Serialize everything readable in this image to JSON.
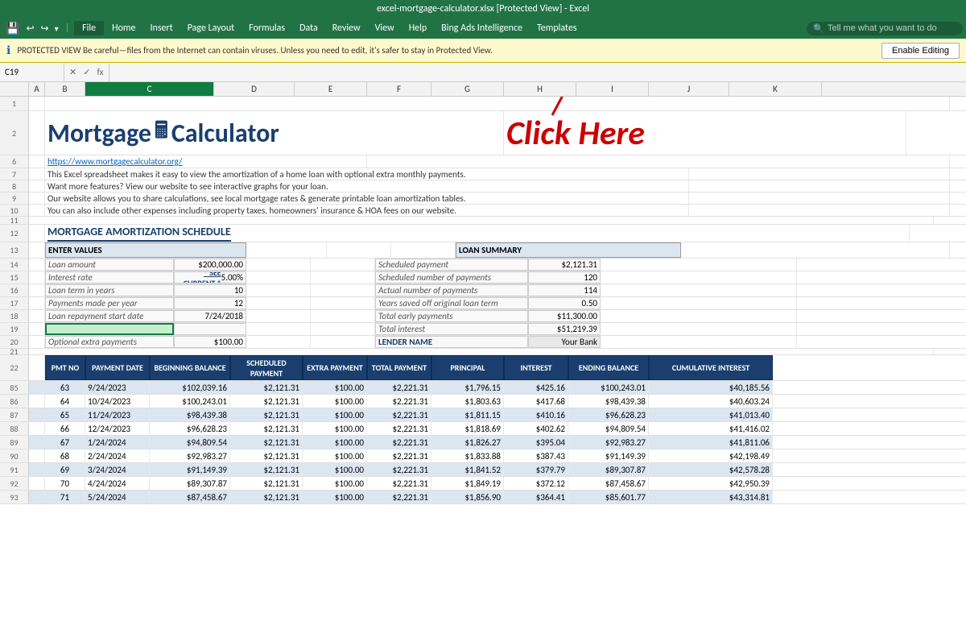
{
  "titlebar": {
    "text": "excel-mortgage-calculator.xlsx [Protected View] - Excel"
  },
  "quickaccess": {
    "save": "💾",
    "undo": "↩",
    "redo": "↪"
  },
  "menubar": {
    "file": "File",
    "items": [
      "Home",
      "Insert",
      "Page Layout",
      "Formulas",
      "Data",
      "Review",
      "View",
      "Help",
      "Bing Ads Intelligence",
      "Templates"
    ],
    "search_placeholder": "Tell me what you want to do"
  },
  "protected": {
    "icon": "ℹ",
    "message": "PROTECTED VIEW  Be careful—files from the Internet can contain viruses. Unless you need to edit, it's safer to stay in Protected View.",
    "button": "Enable Editing"
  },
  "formula_bar": {
    "cell_ref": "C19",
    "formula": ""
  },
  "columns": [
    "A",
    "B",
    "C",
    "D",
    "E",
    "F",
    "G",
    "H",
    "I",
    "J",
    "K"
  ],
  "mortgage": {
    "title_part1": "Mortgage",
    "title_part2": "Calculator",
    "click_here": "Click Here",
    "link": "https://www.mortgagecalculator.org/",
    "desc1": "This Excel spreadsheet makes it easy to view the amortization of a home loan with optional extra monthly payments.",
    "desc2": "Want more features? View our website to see interactive graphs for your loan.",
    "desc3": "Our website allows you to share calculations, see local mortgage rates & generate printable loan amortization tables.",
    "desc4": "You can also include other expenses including property taxes, homeowners' insurance & HOA fees on our website.",
    "section_title": "MORTGAGE AMORTIZATION SCHEDULE"
  },
  "enter_values": {
    "header": "ENTER VALUES",
    "rows": [
      {
        "label": "Loan amount",
        "value": "$200,000.00"
      },
      {
        "label": "Interest rate",
        "see_current": "* SEE CURRENT *",
        "value": "5.00%"
      },
      {
        "label": "Loan term in years",
        "value": "10"
      },
      {
        "label": "Payments made per year",
        "value": "12"
      },
      {
        "label": "Loan repayment start date",
        "value": "7/24/2018"
      },
      {
        "label": "",
        "value": ""
      },
      {
        "label": "Optional extra payments",
        "value": "$100.00"
      }
    ]
  },
  "loan_summary": {
    "header": "LOAN SUMMARY",
    "rows": [
      {
        "label": "Scheduled payment",
        "value": "$2,121.31"
      },
      {
        "label": "Scheduled number of payments",
        "value": "120"
      },
      {
        "label": "Actual number of payments",
        "value": "114"
      },
      {
        "label": "Years saved off original loan term",
        "value": "0.50"
      },
      {
        "label": "Total early payments",
        "value": "$11,300.00"
      },
      {
        "label": "Total interest",
        "value": "$51,219.39"
      }
    ],
    "lender_label": "LENDER NAME",
    "lender_value": "Your Bank"
  },
  "table": {
    "headers": [
      "PMT NO",
      "PAYMENT DATE",
      "BEGINNING BALANCE",
      "SCHEDULED PAYMENT",
      "EXTRA PAYMENT",
      "TOTAL PAYMENT",
      "PRINCIPAL",
      "INTEREST",
      "ENDING BALANCE",
      "CUMULATIVE INTEREST"
    ],
    "rows": [
      {
        "row_num": "85",
        "pmt": "63",
        "date": "9/24/2023",
        "begin_bal": "$102,039.16",
        "sched_pay": "$2,121.31",
        "extra": "$100.00",
        "total_pay": "$2,221.31",
        "principal": "$1,796.15",
        "interest": "$425.16",
        "end_bal": "$100,243.01",
        "cum_int": "$40,185.56"
      },
      {
        "row_num": "86",
        "pmt": "64",
        "date": "10/24/2023",
        "begin_bal": "$100,243.01",
        "sched_pay": "$2,121.31",
        "extra": "$100.00",
        "total_pay": "$2,221.31",
        "principal": "$1,803.63",
        "interest": "$417.68",
        "end_bal": "$98,439.38",
        "cum_int": "$40,603.24"
      },
      {
        "row_num": "87",
        "pmt": "65",
        "date": "11/24/2023",
        "begin_bal": "$98,439.38",
        "sched_pay": "$2,121.31",
        "extra": "$100.00",
        "total_pay": "$2,221.31",
        "principal": "$1,811.15",
        "interest": "$410.16",
        "end_bal": "$96,628.23",
        "cum_int": "$41,013.40"
      },
      {
        "row_num": "88",
        "pmt": "66",
        "date": "12/24/2023",
        "begin_bal": "$96,628.23",
        "sched_pay": "$2,121.31",
        "extra": "$100.00",
        "total_pay": "$2,221.31",
        "principal": "$1,818.69",
        "interest": "$402.62",
        "end_bal": "$94,809.54",
        "cum_int": "$41,416.02"
      },
      {
        "row_num": "89",
        "pmt": "67",
        "date": "1/24/2024",
        "begin_bal": "$94,809.54",
        "sched_pay": "$2,121.31",
        "extra": "$100.00",
        "total_pay": "$2,221.31",
        "principal": "$1,826.27",
        "interest": "$395.04",
        "end_bal": "$92,983.27",
        "cum_int": "$41,811.06"
      },
      {
        "row_num": "90",
        "pmt": "68",
        "date": "2/24/2024",
        "begin_bal": "$92,983.27",
        "sched_pay": "$2,121.31",
        "extra": "$100.00",
        "total_pay": "$2,221.31",
        "principal": "$1,833.88",
        "interest": "$387.43",
        "end_bal": "$91,149.39",
        "cum_int": "$42,198.49"
      },
      {
        "row_num": "91",
        "pmt": "69",
        "date": "3/24/2024",
        "begin_bal": "$91,149.39",
        "sched_pay": "$2,121.31",
        "extra": "$100.00",
        "total_pay": "$2,221.31",
        "principal": "$1,841.52",
        "interest": "$379.79",
        "end_bal": "$89,307.87",
        "cum_int": "$42,578.28"
      },
      {
        "row_num": "92",
        "pmt": "70",
        "date": "4/24/2024",
        "begin_bal": "$89,307.87",
        "sched_pay": "$2,121.31",
        "extra": "$100.00",
        "total_pay": "$2,221.31",
        "principal": "$1,849.19",
        "interest": "$372.12",
        "end_bal": "$87,458.67",
        "cum_int": "$42,950.39"
      },
      {
        "row_num": "93",
        "pmt": "71",
        "date": "5/24/2024",
        "begin_bal": "$87,458.67",
        "sched_pay": "$2,121.31",
        "extra": "$100.00",
        "total_pay": "$2,221.31",
        "principal": "$1,856.90",
        "interest": "$364.41",
        "end_bal": "$85,601.77",
        "cum_int": "$43,314.81"
      }
    ]
  }
}
